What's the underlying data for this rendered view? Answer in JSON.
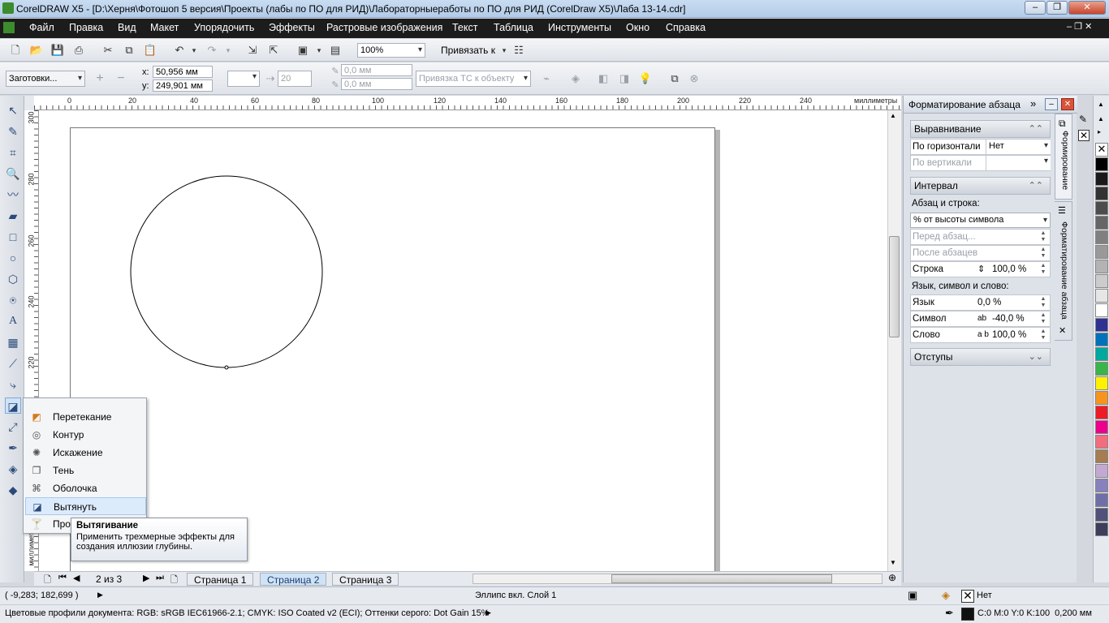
{
  "window": {
    "title": "CorelDRAW X5 - [D:\\Херня\\Фотошоп 5 версия\\Проекты (лабы по ПО для РИД)\\Лабораторныеработы по ПО для РИД (CorelDraw X5)\\Лаба 13-14.cdr]"
  },
  "menu": [
    "Файл",
    "Правка",
    "Вид",
    "Макет",
    "Упорядочить",
    "Эффекты",
    "Растровые изображения",
    "Текст",
    "Таблица",
    "Инструменты",
    "Окно",
    "Справка"
  ],
  "toolbar": {
    "zoom": "100%",
    "snap": "Привязать к"
  },
  "property": {
    "presets": "Заготовки...",
    "x_label": "x:",
    "x": "50,956 мм",
    "y_label": "y:",
    "y": "249,901 мм",
    "steps": "20",
    "offset1": "0,0 мм",
    "offset2": "0,0 мм",
    "snap_obj": "Привязка ТС к объекту"
  },
  "ruler": {
    "unit": "миллиметры",
    "top_ticks": [
      "0",
      "20",
      "40",
      "60",
      "80",
      "100",
      "120",
      "140",
      "160",
      "180",
      "200",
      "220",
      "240"
    ],
    "left_ticks": [
      "300",
      "280",
      "260",
      "240",
      "220"
    ]
  },
  "pages": {
    "counter": "2 из 3",
    "tabs": [
      "Страница 1",
      "Страница 2",
      "Страница 3"
    ]
  },
  "status": {
    "coords": "( -9,283; 182,699 )",
    "object": "Эллипс вкл. Слой 1",
    "fill": "Нет",
    "profiles": "Цветовые профили документа: RGB: sRGB IEC61966-2.1; CMYK: ISO Coated v2 (ECI); Оттенки серого: Dot Gain 15%",
    "outline": "C:0 M:0 Y:0 K:100  0,200 мм"
  },
  "docker": {
    "title": "Форматирование абзаца",
    "align": {
      "header": "Выравнивание",
      "horiz_label": "По горизонтали",
      "horiz_value": "Нет",
      "vert_label": "По вертикали"
    },
    "spacing": {
      "header": "Интервал",
      "para_line": "Абзац и строка:",
      "mode": "% от высоты символа",
      "before": "Перед абзац...",
      "after": "После абзацев",
      "line_label": "Строка",
      "line_value": "100,0 %",
      "lang_char_word": "Язык, символ и слово:",
      "lang_label": "Язык",
      "lang_value": "0,0 %",
      "char_label": "Символ",
      "char_value": "-40,0 %",
      "word_label": "Слово",
      "word_value": "100,0 %"
    },
    "indents": {
      "header": "Отступы"
    },
    "vtab1": "Формирование",
    "vtab2": "Форматирование абзаца"
  },
  "flyout": {
    "items": [
      "Перетекание",
      "Контур",
      "Искажение",
      "Тень",
      "Оболочка",
      "Вытянуть",
      "Про"
    ]
  },
  "tooltip": {
    "title": "Вытягивание",
    "text": "Применить трехмерные эффекты для создания иллюзии глубины."
  },
  "palette": [
    "#ffffff",
    "#000000",
    "#1a1a1a",
    "#333333",
    "#4d4d4d",
    "#666666",
    "#808080",
    "#999999",
    "#b3b3b3",
    "#cccccc",
    "#e6e6e6",
    "#ffffff",
    "#2e3192",
    "#0072bc",
    "#00a99d",
    "#39b54a",
    "#fff200",
    "#f7941d",
    "#ed1c24",
    "#ec008c",
    "#f26d7d",
    "#a67c52",
    "#c4a8d4",
    "#8781bd",
    "#6f6fa8",
    "#51517a",
    "#3d3d5c"
  ]
}
